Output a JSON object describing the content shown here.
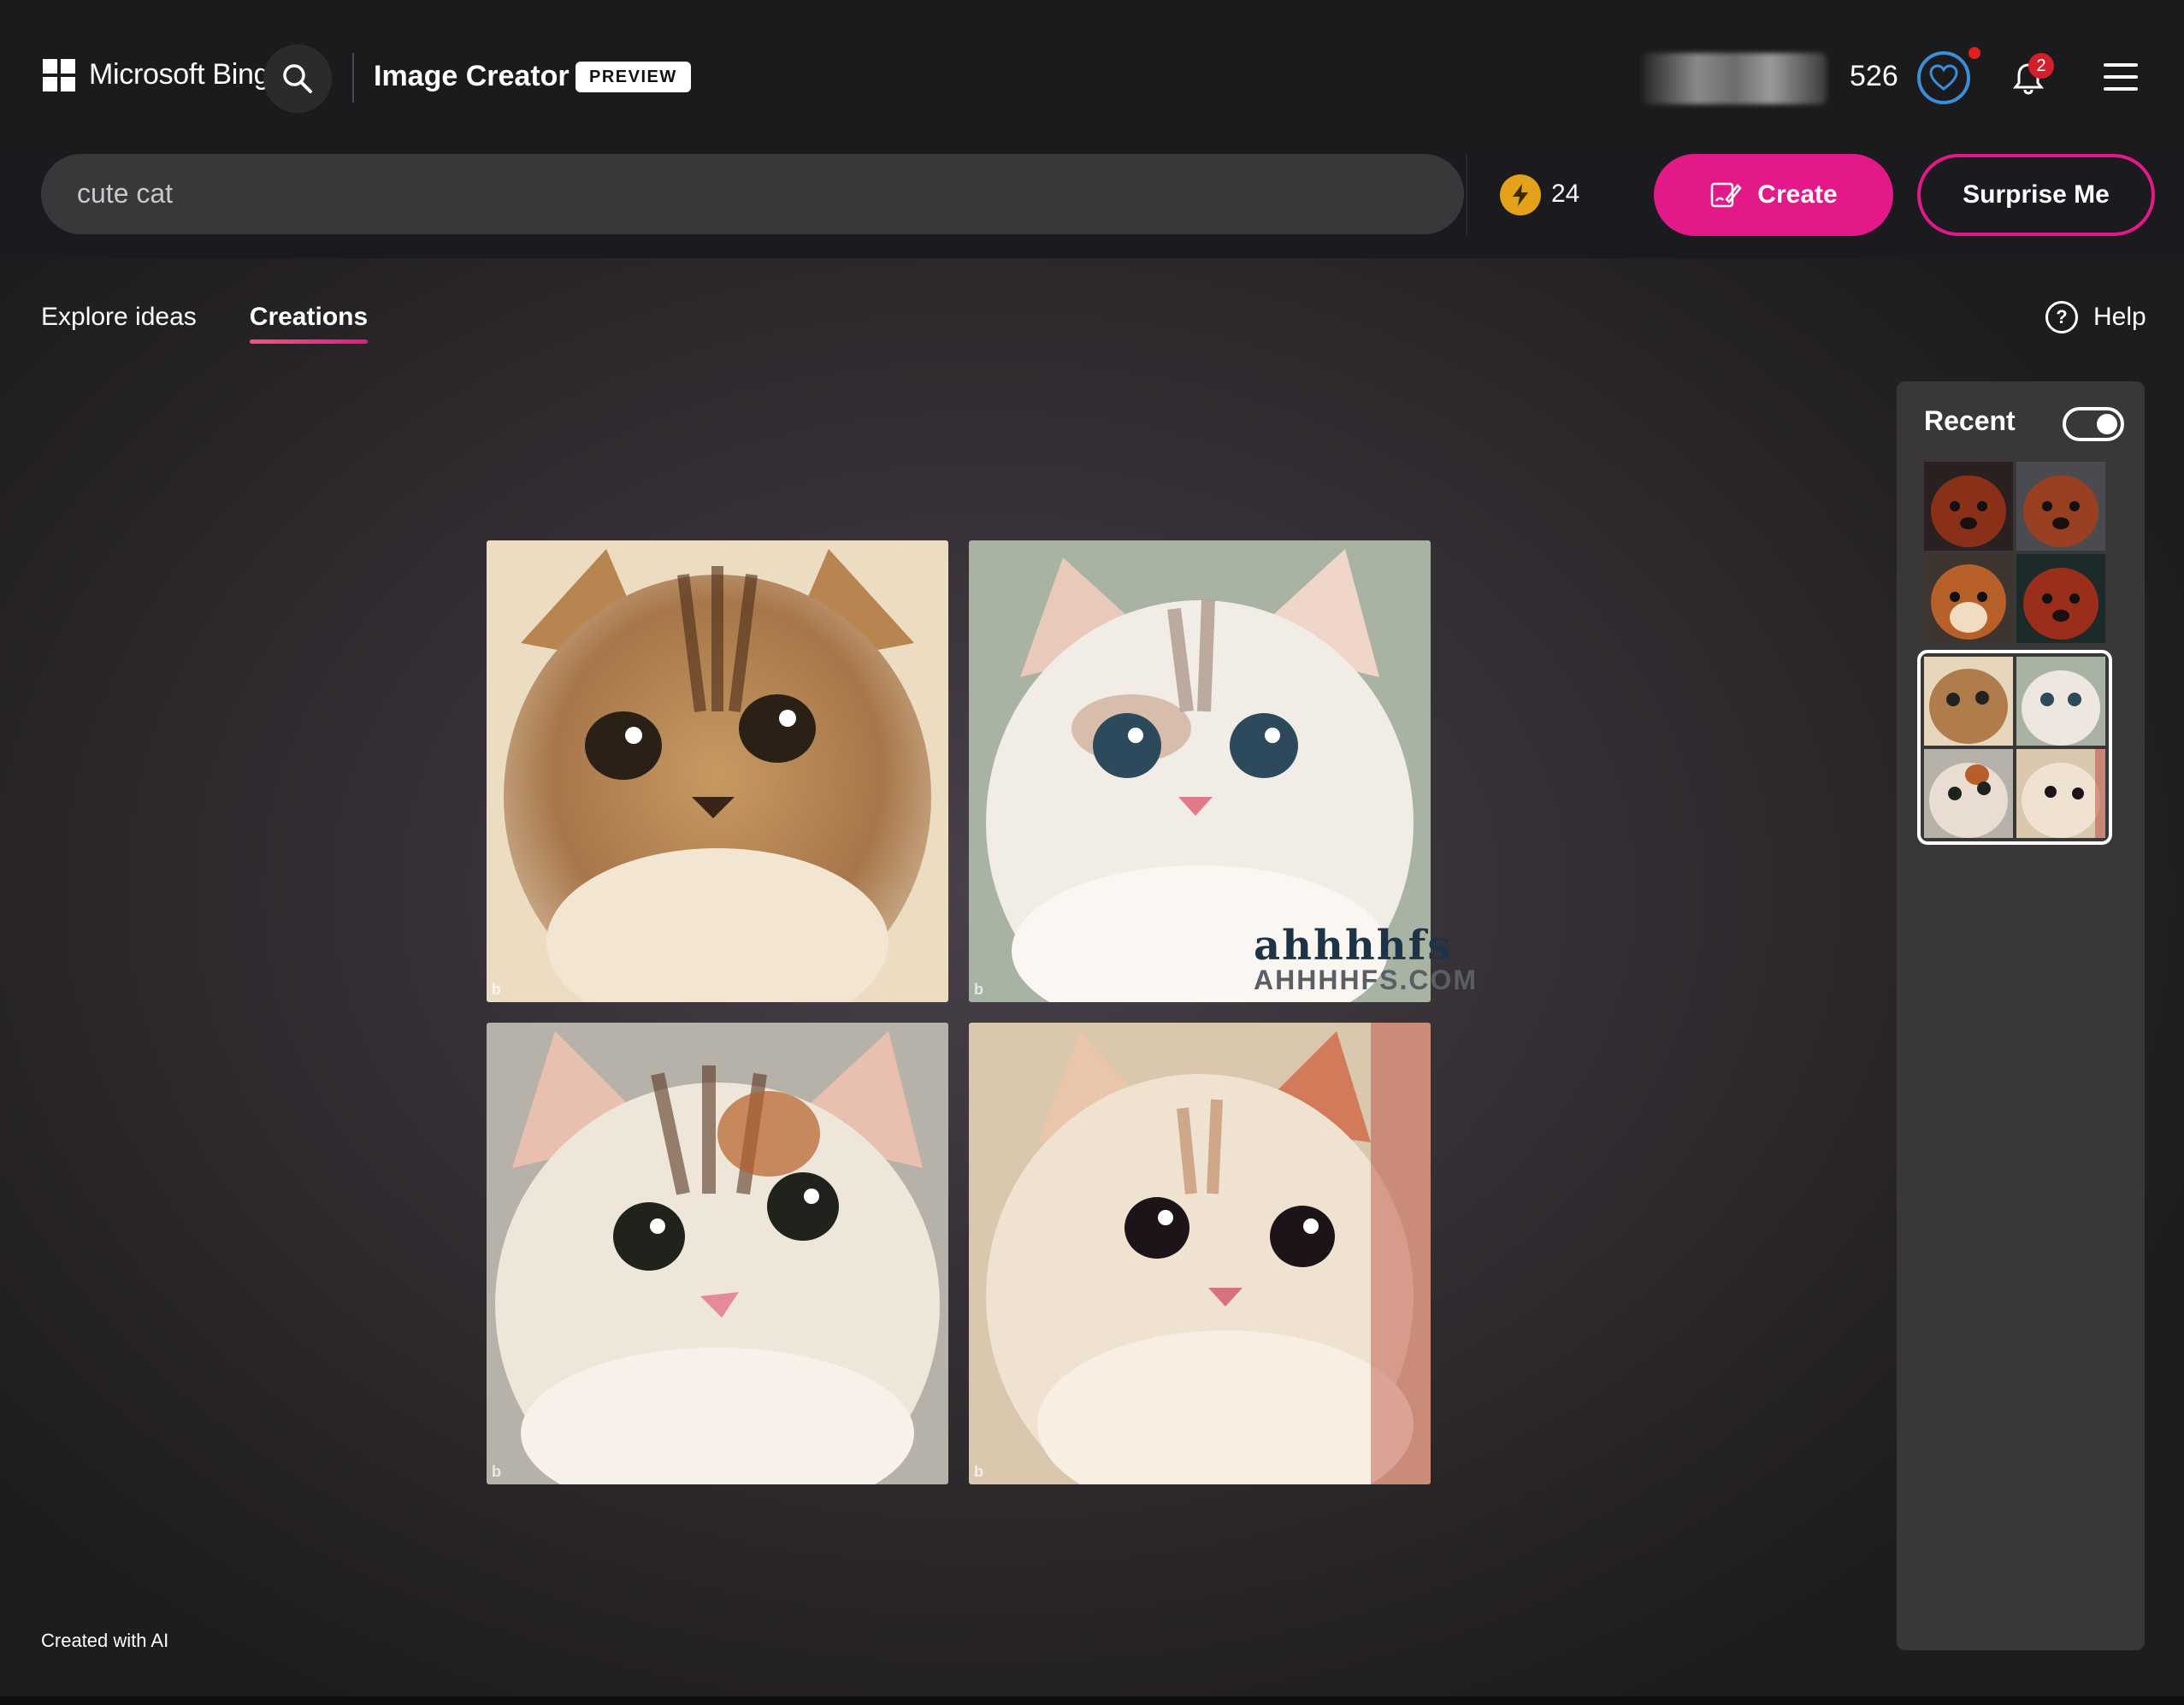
{
  "header": {
    "brand": "Microsoft Bing",
    "app_title": "Image Creator",
    "badge": "PREVIEW",
    "points": "526",
    "notifications_count": "2",
    "icons": [
      "windows-logo-icon",
      "search-icon",
      "rewards-heart-icon",
      "bell-icon",
      "hamburger-menu-icon"
    ]
  },
  "prompt": {
    "value": "cute cat",
    "boosts": "24",
    "create_label": "Create",
    "surprise_label": "Surprise Me"
  },
  "tabs": [
    {
      "label": "Explore ideas",
      "active": false
    },
    {
      "label": "Creations",
      "active": true
    }
  ],
  "help_label": "Help",
  "images": [
    {
      "alt": "tabby kitten",
      "mark": "b"
    },
    {
      "alt": "white and grey kitten with blue eyes",
      "mark": "b"
    },
    {
      "alt": "calico kitten",
      "mark": "b"
    },
    {
      "alt": "cream kitten",
      "mark": "b"
    }
  ],
  "watermark": {
    "line1": "ahhhhfs",
    "line2": "AHHHHFS.COM"
  },
  "recent": {
    "title": "Recent",
    "toggle_on": true,
    "groups": [
      "red puppies",
      "cute cat"
    ]
  },
  "footer_note": "Created with AI",
  "colors": {
    "accent": "#e3198a",
    "header_bg": "#1b1b1d",
    "rewards_ring": "#3b8ed8",
    "boost": "#e3a21a",
    "badge_red": "#d41f2a"
  }
}
